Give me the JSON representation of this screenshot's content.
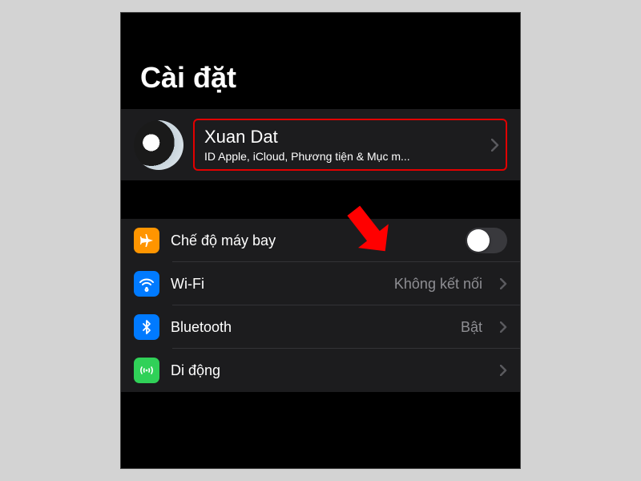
{
  "header": {
    "title": "Cài đặt"
  },
  "profile": {
    "name": "Xuan Dat",
    "subtitle": "ID Apple, iCloud, Phương tiện & Mục m..."
  },
  "rows": {
    "airplane": {
      "label": "Chế độ máy bay"
    },
    "wifi": {
      "label": "Wi-Fi",
      "value": "Không kết nối"
    },
    "bluetooth": {
      "label": "Bluetooth",
      "value": "Bật"
    },
    "cellular": {
      "label": "Di động"
    }
  }
}
